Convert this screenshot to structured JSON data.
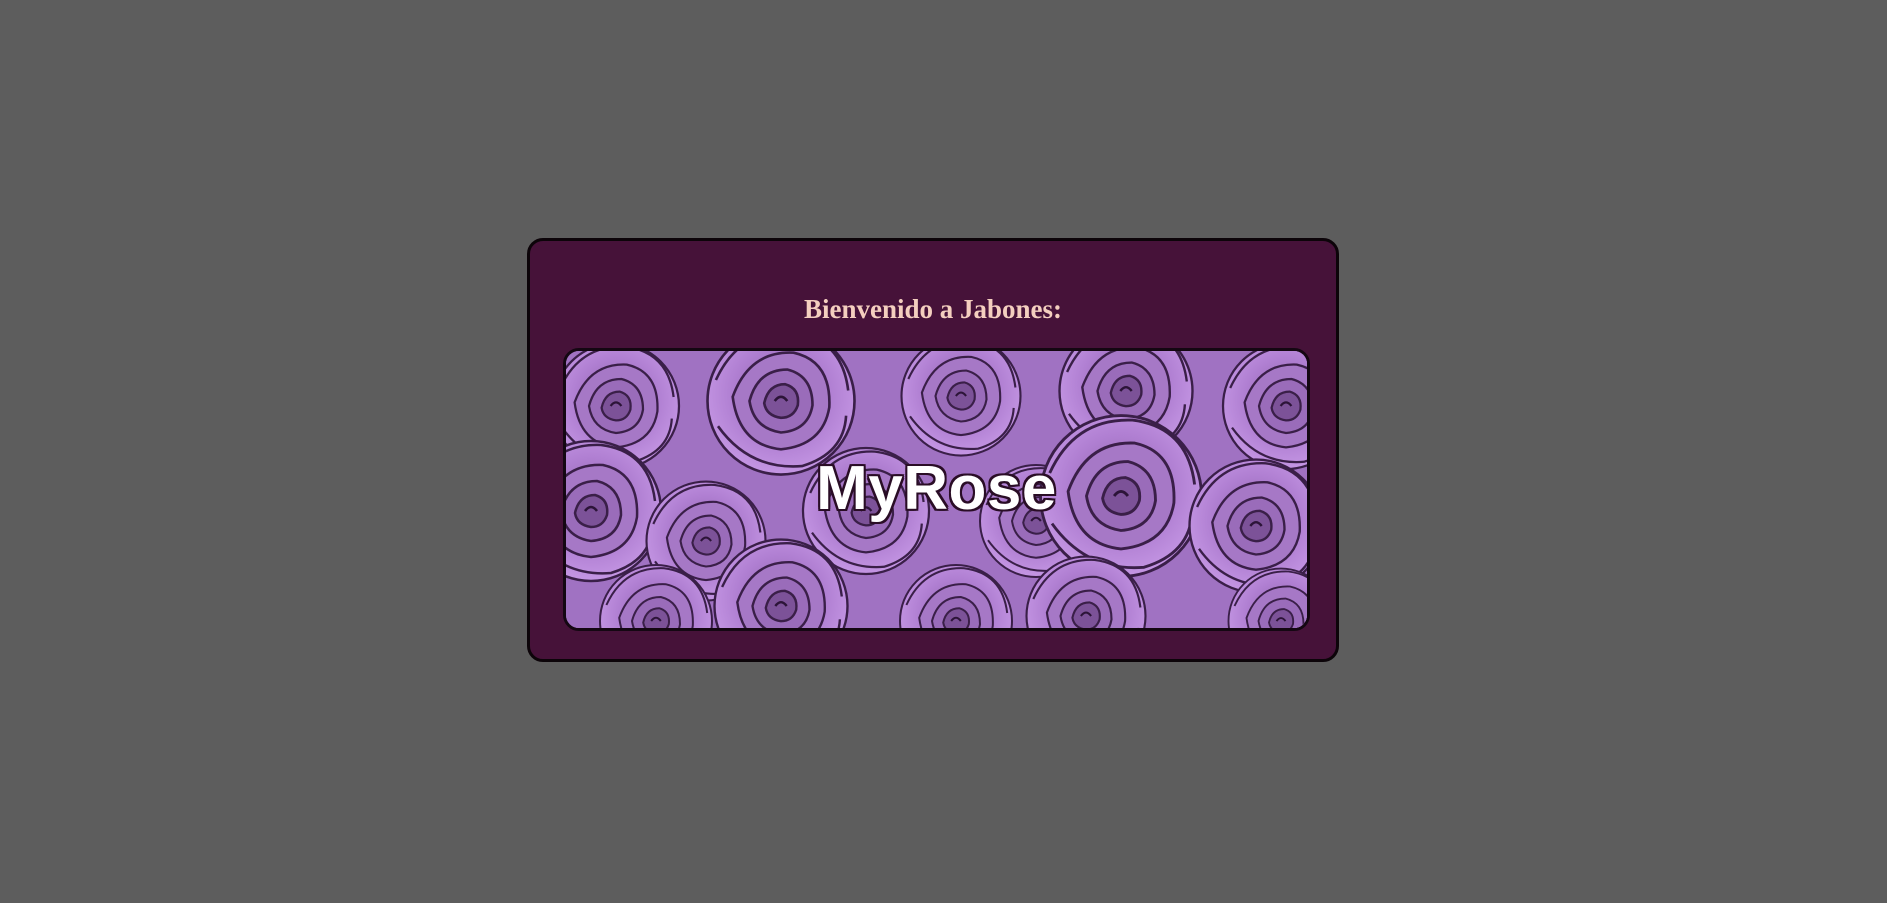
{
  "card": {
    "title": "Bienvenido a Jabones:"
  },
  "banner": {
    "brand": "MyRose",
    "background": "roses-pattern-image"
  },
  "colors": {
    "page_background": "#5d5d5d",
    "card_background": "#461239",
    "title_color": "#f4cfbf",
    "rose_light": "#c592e6",
    "rose_mid": "#a476c4",
    "rose_dark": "#5a3a6e"
  }
}
